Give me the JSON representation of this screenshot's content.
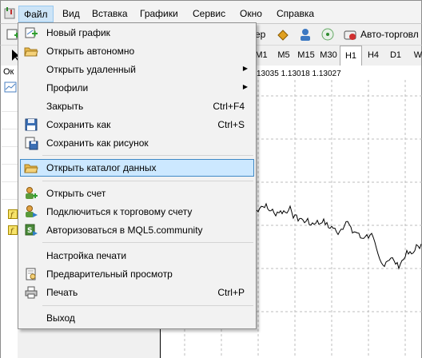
{
  "menubar": {
    "items": [
      "Файл",
      "Вид",
      "Вставка",
      "Графики",
      "Сервис",
      "Окно",
      "Справка"
    ]
  },
  "toolbar": {
    "partial_label": "ер",
    "auto_trading_label": "Авто-торговл"
  },
  "timeframes": {
    "items": [
      "M1",
      "M5",
      "M15",
      "M30",
      "H1",
      "H4",
      "D1",
      "W"
    ],
    "selected": "H1"
  },
  "chart": {
    "info_text": "13035 1.13018 1.13027"
  },
  "navigator": {
    "title_partial": "Ок"
  },
  "file_menu": {
    "items": [
      {
        "label": "Новый график",
        "shortcut": "",
        "icon": "new-chart-icon",
        "submenu": false
      },
      {
        "label": "Открыть автономно",
        "shortcut": "",
        "icon": "folder-open-icon",
        "submenu": false
      },
      {
        "label": "Открыть удаленный",
        "shortcut": "",
        "icon": "",
        "submenu": true
      },
      {
        "label": "Профили",
        "shortcut": "",
        "icon": "",
        "submenu": true
      },
      {
        "label": "Закрыть",
        "shortcut": "Ctrl+F4",
        "icon": "",
        "submenu": false
      },
      {
        "label": "Сохранить как",
        "shortcut": "Ctrl+S",
        "icon": "save-icon",
        "submenu": false
      },
      {
        "label": "Сохранить как рисунок",
        "shortcut": "",
        "icon": "save-picture-icon",
        "submenu": false
      },
      {
        "label": "Открыть каталог данных",
        "shortcut": "",
        "icon": "folder-icon",
        "submenu": false,
        "highlighted": true
      },
      {
        "label": "Открыть счет",
        "shortcut": "",
        "icon": "open-account-icon",
        "submenu": false
      },
      {
        "label": "Подключиться к торговому счету",
        "shortcut": "",
        "icon": "connect-account-icon",
        "submenu": false
      },
      {
        "label": "Авторизоваться в MQL5.community",
        "shortcut": "",
        "icon": "mql5-login-icon",
        "submenu": false
      },
      {
        "label": "Настройка печати",
        "shortcut": "",
        "icon": "",
        "submenu": false
      },
      {
        "label": "Предварительный просмотр",
        "shortcut": "",
        "icon": "print-preview-icon",
        "submenu": false
      },
      {
        "label": "Печать",
        "shortcut": "Ctrl+P",
        "icon": "printer-icon",
        "submenu": false
      },
      {
        "label": "Выход",
        "shortcut": "",
        "icon": "",
        "submenu": false
      }
    ]
  },
  "colors": {
    "menu_highlight": "#cce8ff",
    "menu_highlight_border": "#3f89c6",
    "menubar_active": "#cce4f7"
  }
}
